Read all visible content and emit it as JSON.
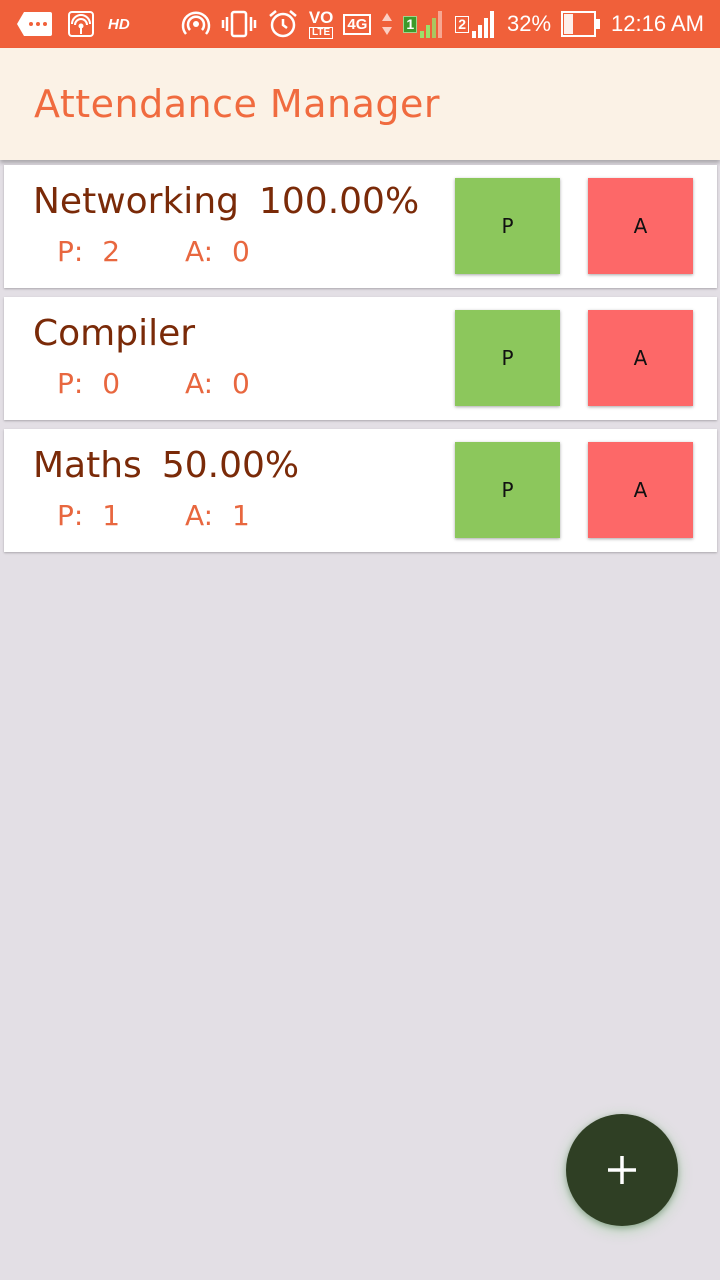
{
  "status_bar": {
    "hd": "HD",
    "volte_top": "VO",
    "volte_bottom": "LTE",
    "network": "4G",
    "sim1": "1",
    "sim2": "2",
    "battery_percent": "32%",
    "time": "12:16 AM",
    "battery_level": 0.32
  },
  "app_bar": {
    "title": "Attendance Manager"
  },
  "subjects": [
    {
      "name": "Networking",
      "percent": "100.00%",
      "present_label": "P:",
      "present": "2",
      "absent_label": "A:",
      "absent": "0",
      "p_button": "P",
      "a_button": "A"
    },
    {
      "name": "Compiler",
      "percent": "",
      "present_label": "P:",
      "present": "0",
      "absent_label": "A:",
      "absent": "0",
      "p_button": "P",
      "a_button": "A"
    },
    {
      "name": "Maths",
      "percent": "50.00%",
      "present_label": "P:",
      "present": "1",
      "absent_label": "A:",
      "absent": "1",
      "p_button": "P",
      "a_button": "A"
    }
  ],
  "fab": {
    "icon": "plus-icon"
  },
  "colors": {
    "status_bar": "#f0603a",
    "app_bar": "#fbf2e6",
    "title": "#f06b3f",
    "subject_name": "#7a2a08",
    "counts": "#e8673f",
    "present_button": "#8cc75c",
    "absent_button": "#fd6868",
    "fab": "#2f3f24",
    "background": "#e3dfe5"
  }
}
